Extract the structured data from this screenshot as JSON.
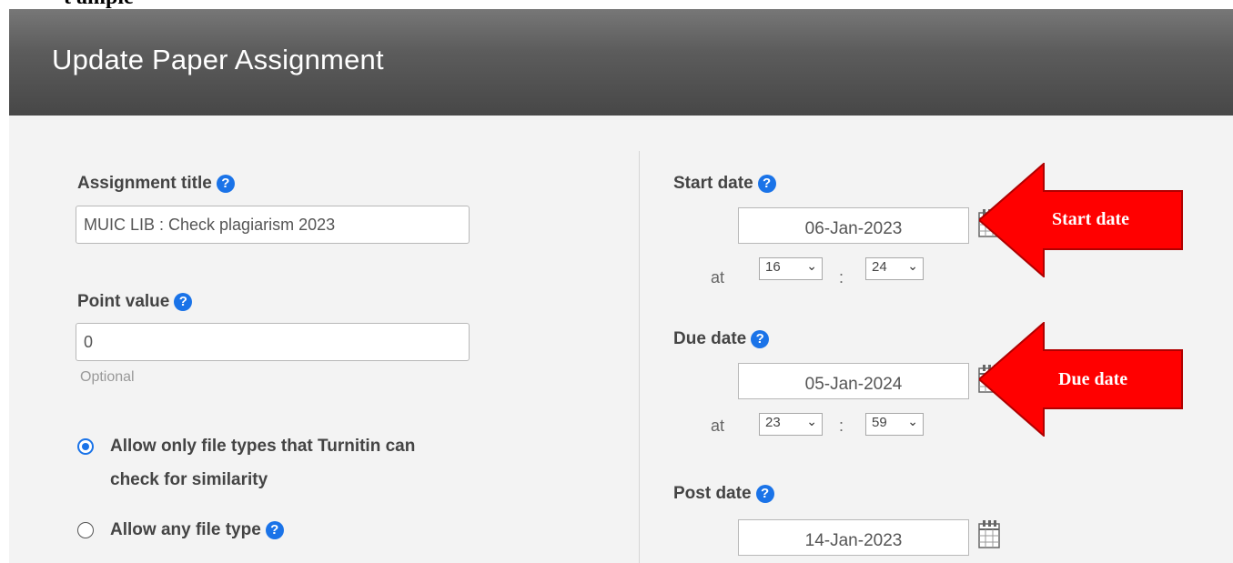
{
  "page_top_fragment": "t ample",
  "dialog": {
    "title": "Update Paper Assignment"
  },
  "left": {
    "assignment_title": {
      "label": "Assignment title",
      "value": "MUIC LIB : Check plagiarism 2023"
    },
    "point_value": {
      "label": "Point value",
      "value": "0",
      "hint": "Optional"
    },
    "file_types": [
      {
        "label_line1": "Allow only file types that Turnitin can",
        "label_line2": "check for similarity",
        "selected": true
      },
      {
        "label_line1": "Allow any file type",
        "selected": false
      }
    ]
  },
  "right": {
    "start_date": {
      "label": "Start date",
      "value": "06-Jan-2023",
      "at": "at",
      "hour": "16",
      "minute": "24"
    },
    "due_date": {
      "label": "Due date",
      "value": "05-Jan-2024",
      "at": "at",
      "hour": "23",
      "minute": "59"
    },
    "post_date": {
      "label": "Post date",
      "value": "14-Jan-2023"
    }
  },
  "help_glyph": "?",
  "annotations": {
    "start_arrow_label": "Start date",
    "due_arrow_label": "Due date",
    "arrow_color": "#ff0000"
  },
  "icons": [
    "help-icon",
    "calendar-icon",
    "chevron-down-icon",
    "radio-icon"
  ]
}
